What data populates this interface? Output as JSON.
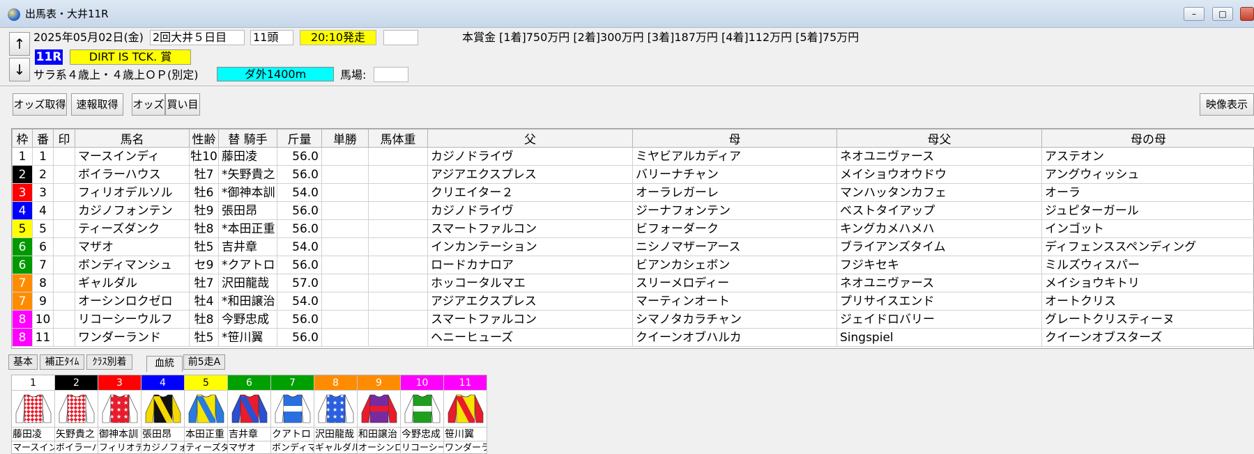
{
  "window": {
    "title": "出馬表・大井11R"
  },
  "race": {
    "date": "2025年05月02日(金)",
    "meeting": "2回大井５日目",
    "runners": "11頭",
    "start_time": "20:10発走",
    "race_no": "11R",
    "race_name": "DIRT IS TCK. 賞",
    "condition": "サラ系４歳上・４歳上ＯＰ(別定)",
    "course": "ダ外1400m",
    "going_label": "馬場:",
    "going_value": "",
    "extra_box": "",
    "prize": "本賞金 [1着]750万円 [2着]300万円 [3着]187万円 [4着]112万円 [5着]75万円"
  },
  "nav": {
    "up": "↑",
    "down": "↓"
  },
  "toolbar": {
    "odds_fetch": "オッズ取得",
    "quick_fetch": "速報取得",
    "odds": "オッズ",
    "bets": "買い目",
    "video": "映像表示"
  },
  "table": {
    "headers": {
      "waku": "枠",
      "umaban": "番",
      "mark": "印",
      "horse": "馬名",
      "sexage": "性齢",
      "jockey": "替 騎手",
      "weight": "斤量",
      "win": "単勝",
      "body": "馬体重",
      "sire": "父",
      "dam": "母",
      "damsire": "母父",
      "damdam": "母の母"
    },
    "rows": [
      {
        "waku": "1",
        "umaban": "1",
        "mark": "",
        "horse": "マースインディ",
        "sexage": "牡10",
        "jockey": " 藤田凌",
        "weight": "56.0",
        "win": "",
        "body": "",
        "sire": "カジノドライヴ",
        "dam": "ミヤビアルカディア",
        "damsire": "ネオユニヴァース",
        "damdam": "アステオン"
      },
      {
        "waku": "2",
        "umaban": "2",
        "mark": "",
        "horse": "ボイラーハウス",
        "sexage": "牡7",
        "jockey": "*矢野貴之",
        "weight": "56.0",
        "win": "",
        "body": "",
        "sire": "アジアエクスプレス",
        "dam": "バリーナチャン",
        "damsire": "メイショウオウドウ",
        "damdam": "アングウィッシュ"
      },
      {
        "waku": "3",
        "umaban": "3",
        "mark": "",
        "horse": "フィリオデルソル",
        "sexage": "牡6",
        "jockey": "*御神本訓",
        "weight": "54.0",
        "win": "",
        "body": "",
        "sire": "クリエイター２",
        "dam": "オーラレガーレ",
        "damsire": "マンハッタンカフェ",
        "damdam": "オーラ"
      },
      {
        "waku": "4",
        "umaban": "4",
        "mark": "",
        "horse": "カジノフォンテン",
        "sexage": "牡9",
        "jockey": " 張田昂",
        "weight": "56.0",
        "win": "",
        "body": "",
        "sire": "カジノドライヴ",
        "dam": "ジーナフォンテン",
        "damsire": "ベストタイアップ",
        "damdam": "ジュピターガール"
      },
      {
        "waku": "5",
        "umaban": "5",
        "mark": "",
        "horse": "ティーズダンク",
        "sexage": "牡8",
        "jockey": "*本田正重",
        "weight": "56.0",
        "win": "",
        "body": "",
        "sire": "スマートファルコン",
        "dam": "ビフォーダーク",
        "damsire": "キングカメハメハ",
        "damdam": "インゴット"
      },
      {
        "waku": "6",
        "umaban": "6",
        "mark": "",
        "horse": "マザオ",
        "sexage": "牡5",
        "jockey": " 吉井章",
        "weight": "54.0",
        "win": "",
        "body": "",
        "sire": "インカンテーション",
        "dam": "ニシノマザーアース",
        "damsire": "ブライアンズタイム",
        "damdam": "ディフェンススペンディング"
      },
      {
        "waku": "6",
        "umaban": "7",
        "mark": "",
        "horse": "ボンディマンシュ",
        "sexage": "セ9",
        "jockey": "*クアトロ",
        "weight": "56.0",
        "win": "",
        "body": "",
        "sire": "ロードカナロア",
        "dam": "ビアンカシェボン",
        "damsire": "フジキセキ",
        "damdam": "ミルズウィスパー"
      },
      {
        "waku": "7",
        "umaban": "8",
        "mark": "",
        "horse": "ギャルダル",
        "sexage": "牡7",
        "jockey": " 沢田龍哉",
        "weight": "57.0",
        "win": "",
        "body": "",
        "sire": "ホッコータルマエ",
        "dam": "スリーメロディー",
        "damsire": "ネオユニヴァース",
        "damdam": "メイショウキトリ"
      },
      {
        "waku": "7",
        "umaban": "9",
        "mark": "",
        "horse": "オーシンロクゼロ",
        "sexage": "牡4",
        "jockey": "*和田譲治",
        "weight": "54.0",
        "win": "",
        "body": "",
        "sire": "アジアエクスプレス",
        "dam": "マーティンオート",
        "damsire": "プリサイスエンド",
        "damdam": "オートクリス"
      },
      {
        "waku": "8",
        "umaban": "10",
        "mark": "",
        "horse": "リコーシーウルフ",
        "sexage": "牡8",
        "jockey": " 今野忠成",
        "weight": "56.0",
        "win": "",
        "body": "",
        "sire": "スマートファルコン",
        "dam": "シマノタカラチャン",
        "damsire": "ジェイドロバリー",
        "damdam": "グレートクリスティーヌ"
      },
      {
        "waku": "8",
        "umaban": "11",
        "mark": "",
        "horse": "ワンダーランド",
        "sexage": "牡5",
        "jockey": "*笹川翼",
        "weight": "56.0",
        "win": "",
        "body": "",
        "sire": "ヘニーヒューズ",
        "dam": "クイーンオブハルカ",
        "damsire": "Singspiel",
        "damdam": "クイーンオブスターズ"
      }
    ]
  },
  "tabs": [
    "基本",
    "補正ﾀｲﾑ",
    "ｸﾗｽ別着",
    "血統",
    "前5走A"
  ],
  "active_tab": "血統",
  "silks": [
    {
      "num": "1",
      "jockey": "藤田凌",
      "horse": "マースイン",
      "frame_color": "#ffffff",
      "silk_color": "#e81c2c",
      "silk_alt": "#ffffff",
      "pattern": "checks"
    },
    {
      "num": "2",
      "jockey": "矢野貴之",
      "horse": "ボイラーハ",
      "frame_color": "#000000",
      "silk_color": "#e81c2c",
      "silk_alt": "#ffffff",
      "pattern": "checks"
    },
    {
      "num": "3",
      "jockey": "御神本訓",
      "horse": "フィリオデ",
      "frame_color": "#ff0000",
      "silk_color": "#e81c2c",
      "silk_alt": "#ffffff",
      "pattern": "stars"
    },
    {
      "num": "4",
      "jockey": "張田昂",
      "horse": "カジノフォ",
      "frame_color": "#0000ff",
      "silk_color": "#111111",
      "silk_alt": "#f5d800",
      "pattern": "sash"
    },
    {
      "num": "5",
      "jockey": "本田正重",
      "horse": "ティーズダ",
      "frame_color": "#ffff00",
      "silk_color": "#f5e600",
      "silk_alt": "#2a7be0",
      "pattern": "sash"
    },
    {
      "num": "6",
      "jockey": "吉井章",
      "horse": "マザオ",
      "frame_color": "#00a000",
      "silk_color": "#e81c2c",
      "silk_alt": "#2a4fd0",
      "pattern": "sash"
    },
    {
      "num": "7",
      "jockey": "クアトロ",
      "horse": "ボンディマ",
      "frame_color": "#00a000",
      "silk_color": "#2a6fe0",
      "silk_alt": "#ffffff",
      "pattern": "hoop"
    },
    {
      "num": "8",
      "jockey": "沢田龍哉",
      "horse": "ギャルダル",
      "frame_color": "#ff8c00",
      "silk_color": "#2a5fe0",
      "silk_alt": "#ffffff",
      "pattern": "stars"
    },
    {
      "num": "9",
      "jockey": "和田譲治",
      "horse": "オーシンロ",
      "frame_color": "#ff8c00",
      "silk_color": "#7a2aa0",
      "silk_alt": "#e81c2c",
      "pattern": "hoop"
    },
    {
      "num": "10",
      "jockey": "今野忠成",
      "horse": "リコーシー",
      "frame_color": "#ff00ff",
      "silk_color": "#1ea01e",
      "silk_alt": "#ffffff",
      "pattern": "hoop"
    },
    {
      "num": "11",
      "jockey": "笹川翼",
      "horse": "ワンダーラ",
      "frame_color": "#ff00ff",
      "silk_color": "#f5e600",
      "silk_alt": "#e81c2c",
      "pattern": "sash"
    }
  ],
  "colors": {
    "waku": {
      "1": "#ffffff",
      "2": "#000000",
      "3": "#ff0000",
      "4": "#0000ff",
      "5": "#ffff00",
      "6": "#009900",
      "7": "#ff8c00",
      "8": "#ff00ff"
    },
    "start_time_bg": "#ffff00",
    "course_bg": "#00ffff",
    "race_no_bg": "#0000ff"
  }
}
